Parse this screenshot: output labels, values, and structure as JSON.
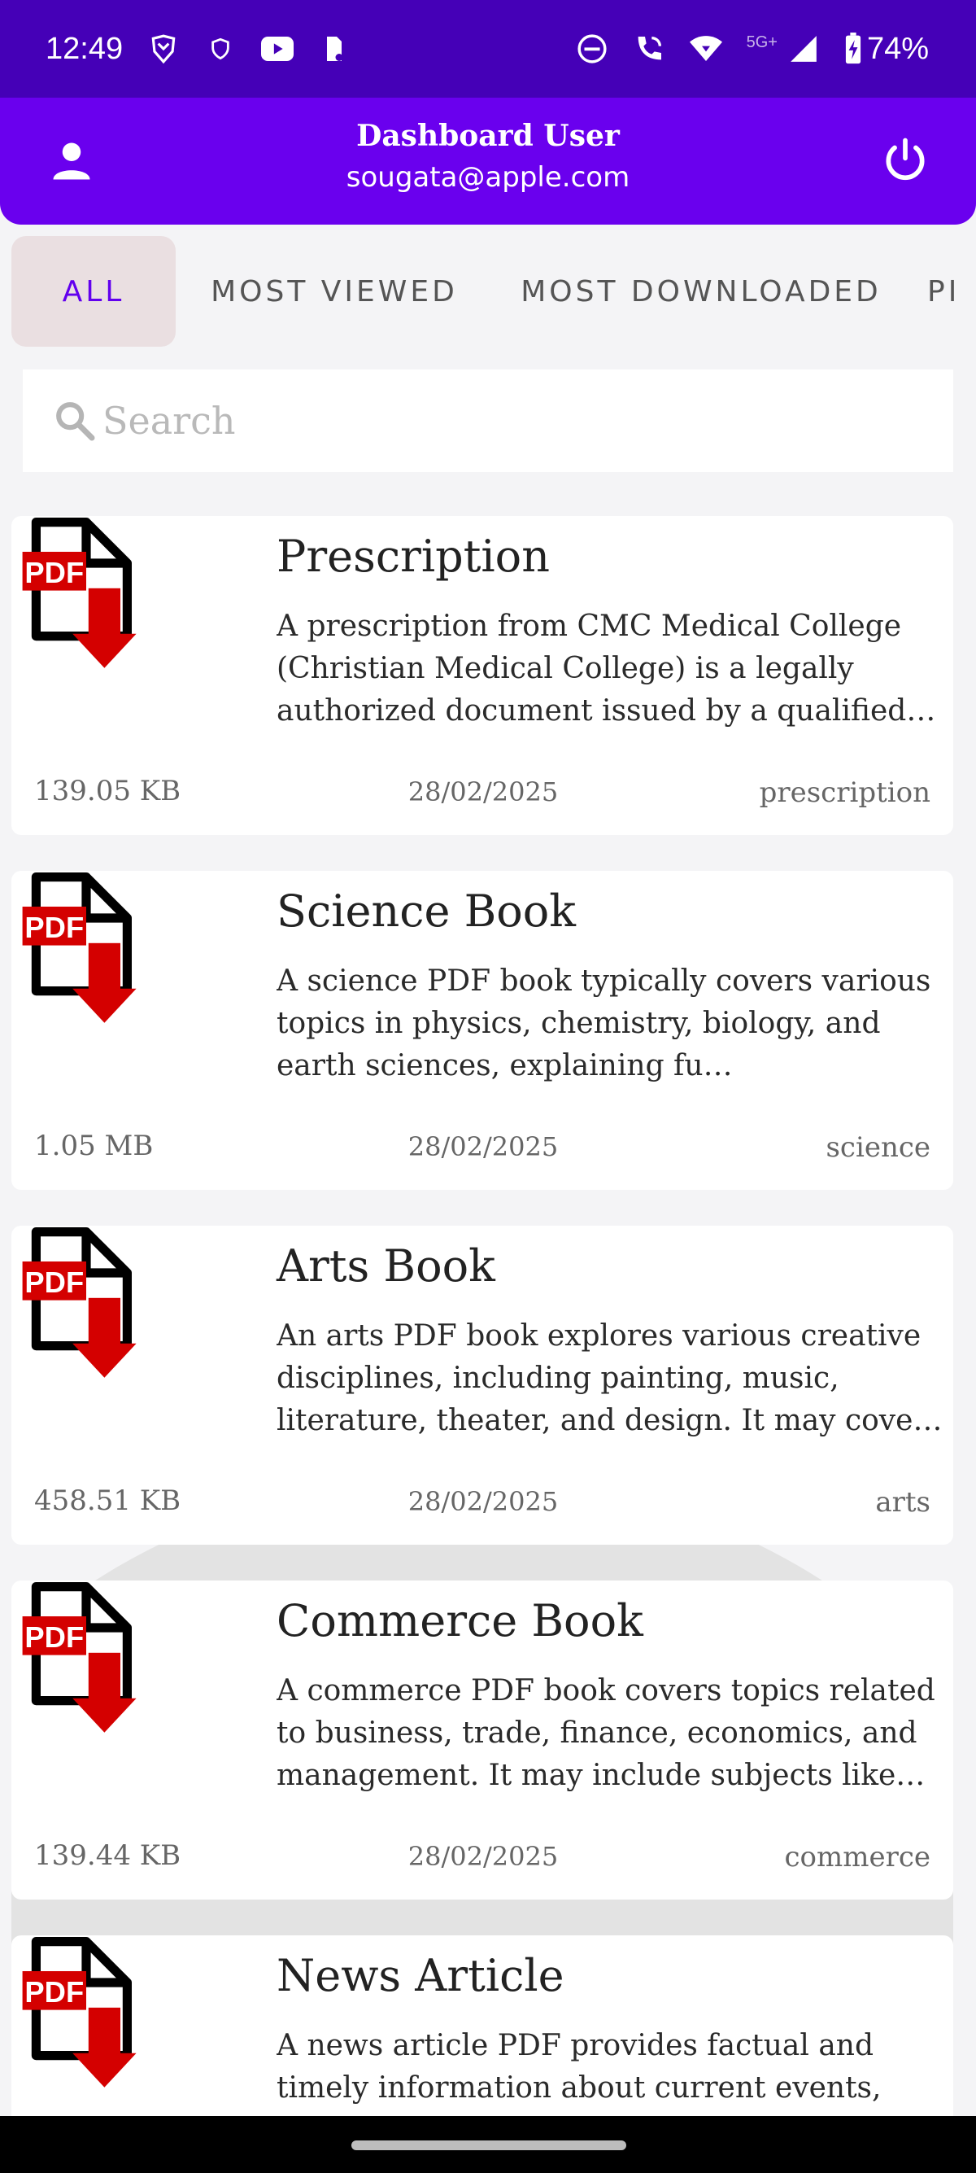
{
  "status_bar": {
    "time": "12:49",
    "network_label": "5G+",
    "battery": "74%"
  },
  "header": {
    "title": "Dashboard User",
    "email": "sougata@apple.com"
  },
  "tabs": [
    {
      "label": "ALL",
      "active": true
    },
    {
      "label": "MOST VIEWED",
      "active": false
    },
    {
      "label": "MOST DOWNLOADED",
      "active": false
    },
    {
      "label": "PI",
      "active": false
    }
  ],
  "search": {
    "placeholder": "Search",
    "value": ""
  },
  "items": [
    {
      "title": "Prescription",
      "description": "A prescription from CMC Medical College (Christian Medical College) is a legally authorized document issued by a qualified…",
      "size": "139.05 KB",
      "date": "28/02/2025",
      "category": "prescription"
    },
    {
      "title": "Science Book",
      "description": "A science PDF book typically covers various topics in physics, chemistry, biology, and earth sciences, explaining fu…",
      "size": "1.05 MB",
      "date": "28/02/2025",
      "category": "science"
    },
    {
      "title": "Arts Book",
      "description": "An arts PDF book explores various creative disciplines, including painting, music, literature, theater, and design. It may cove…",
      "size": "458.51 KB",
      "date": "28/02/2025",
      "category": "arts"
    },
    {
      "title": "Commerce Book",
      "description": "A commerce PDF book covers topics related to business, trade, finance, economics, and management. It may include subjects like…",
      "size": "139.44 KB",
      "date": "28/02/2025",
      "category": "commerce"
    },
    {
      "title": "News Article",
      "description": "A news article PDF provides factual and timely information about current events,",
      "size": "",
      "date": "",
      "category": ""
    }
  ],
  "pdf_badge_text": "PDF",
  "colors": {
    "status_bar": "#4500b7",
    "header": "#6a00ee",
    "accent": "#6200ee",
    "pdf_red": "#d40000",
    "active_tab_bg": "#eadfe1"
  },
  "icons": {
    "header_left": "user-icon",
    "header_right": "power-icon",
    "search": "search-icon",
    "item": "pdf-download-icon"
  }
}
